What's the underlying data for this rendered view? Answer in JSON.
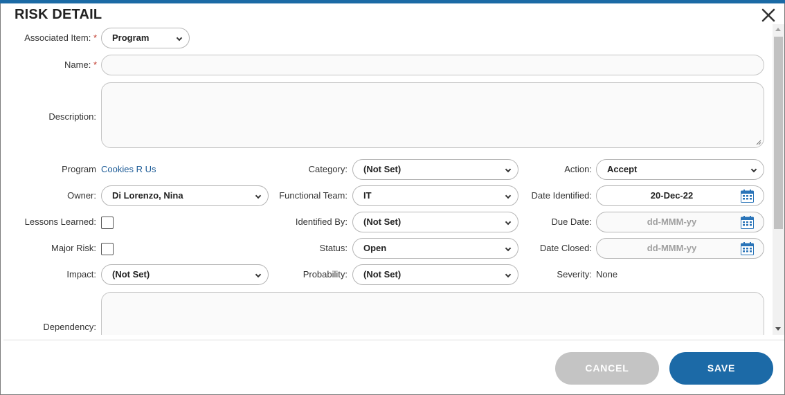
{
  "dialog": {
    "title": "RISK DETAIL"
  },
  "required_marker": "*",
  "fields": {
    "associated_item": {
      "label": "Associated Item:",
      "value": "Program"
    },
    "name": {
      "label": "Name:",
      "value": ""
    },
    "description": {
      "label": "Description:",
      "value": ""
    },
    "program": {
      "label": "Program",
      "value": "Cookies R Us"
    },
    "category": {
      "label": "Category:",
      "value": "(Not Set)"
    },
    "action": {
      "label": "Action:",
      "value": "Accept"
    },
    "owner": {
      "label": "Owner:",
      "value": "Di Lorenzo, Nina"
    },
    "functional_team": {
      "label": "Functional Team:",
      "value": "IT"
    },
    "date_identified": {
      "label": "Date Identified:",
      "value": "20-Dec-22"
    },
    "lessons_learned": {
      "label": "Lessons Learned:",
      "checked": false
    },
    "identified_by": {
      "label": "Identified By:",
      "value": "(Not Set)"
    },
    "due_date": {
      "label": "Due Date:",
      "placeholder": "dd-MMM-yy"
    },
    "major_risk": {
      "label": "Major Risk:",
      "checked": false
    },
    "status": {
      "label": "Status:",
      "value": "Open"
    },
    "date_closed": {
      "label": "Date Closed:",
      "placeholder": "dd-MMM-yy"
    },
    "impact": {
      "label": "Impact:",
      "value": "(Not Set)"
    },
    "probability": {
      "label": "Probability:",
      "value": "(Not Set)"
    },
    "severity": {
      "label": "Severity:",
      "value": "None"
    },
    "dependency": {
      "label": "Dependency:",
      "value": ""
    }
  },
  "buttons": {
    "cancel": "CANCEL",
    "save": "SAVE"
  },
  "icons": {
    "close": "close-icon",
    "calendar": "calendar-icon",
    "chevron": "chevron-down-icon"
  },
  "colors": {
    "accent": "#1c6aa7",
    "link": "#1b5a96",
    "required": "#c0392b",
    "cancel_bg": "#c4c4c4"
  }
}
